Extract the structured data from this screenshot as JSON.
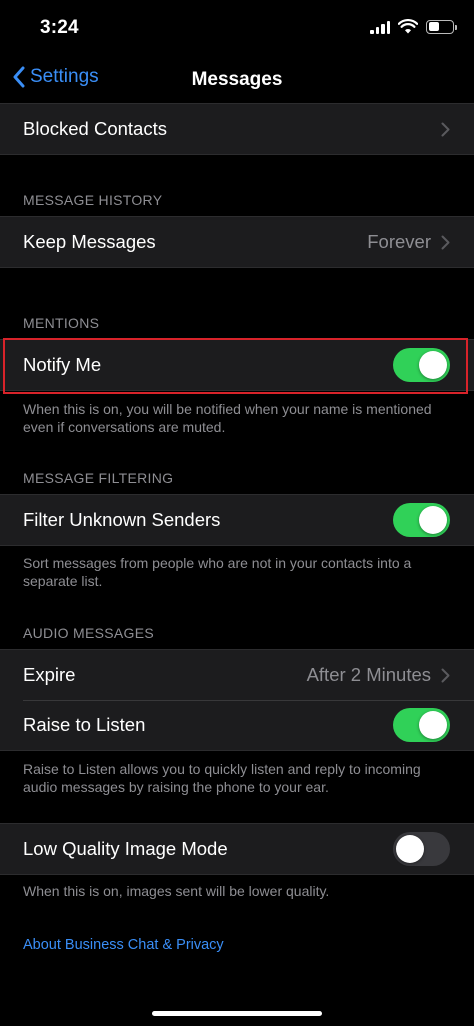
{
  "status_bar": {
    "time": "3:24"
  },
  "nav": {
    "back_label": "Settings",
    "title": "Messages"
  },
  "blocked": {
    "label": "Blocked Contacts"
  },
  "message_history": {
    "header": "MESSAGE HISTORY",
    "keep_label": "Keep Messages",
    "keep_value": "Forever"
  },
  "mentions": {
    "header": "MENTIONS",
    "notify_label": "Notify Me",
    "notify_on": true,
    "footer": "When this is on, you will be notified when your name is mentioned even if conversations are muted."
  },
  "message_filtering": {
    "header": "MESSAGE FILTERING",
    "filter_label": "Filter Unknown Senders",
    "filter_on": true,
    "footer": "Sort messages from people who are not in your contacts into a separate list."
  },
  "audio_messages": {
    "header": "AUDIO MESSAGES",
    "expire_label": "Expire",
    "expire_value": "After 2 Minutes",
    "raise_label": "Raise to Listen",
    "raise_on": true,
    "footer": "Raise to Listen allows you to quickly listen and reply to incoming audio messages by raising the phone to your ear."
  },
  "low_quality": {
    "label": "Low Quality Image Mode",
    "on": false,
    "footer": "When this is on, images sent will be lower quality."
  },
  "about_link": "About Business Chat & Privacy",
  "colors": {
    "accent": "#3a8ef6",
    "toggle_on": "#30d158",
    "highlight": "#d8232a",
    "cell_background": "#1c1c1e"
  }
}
